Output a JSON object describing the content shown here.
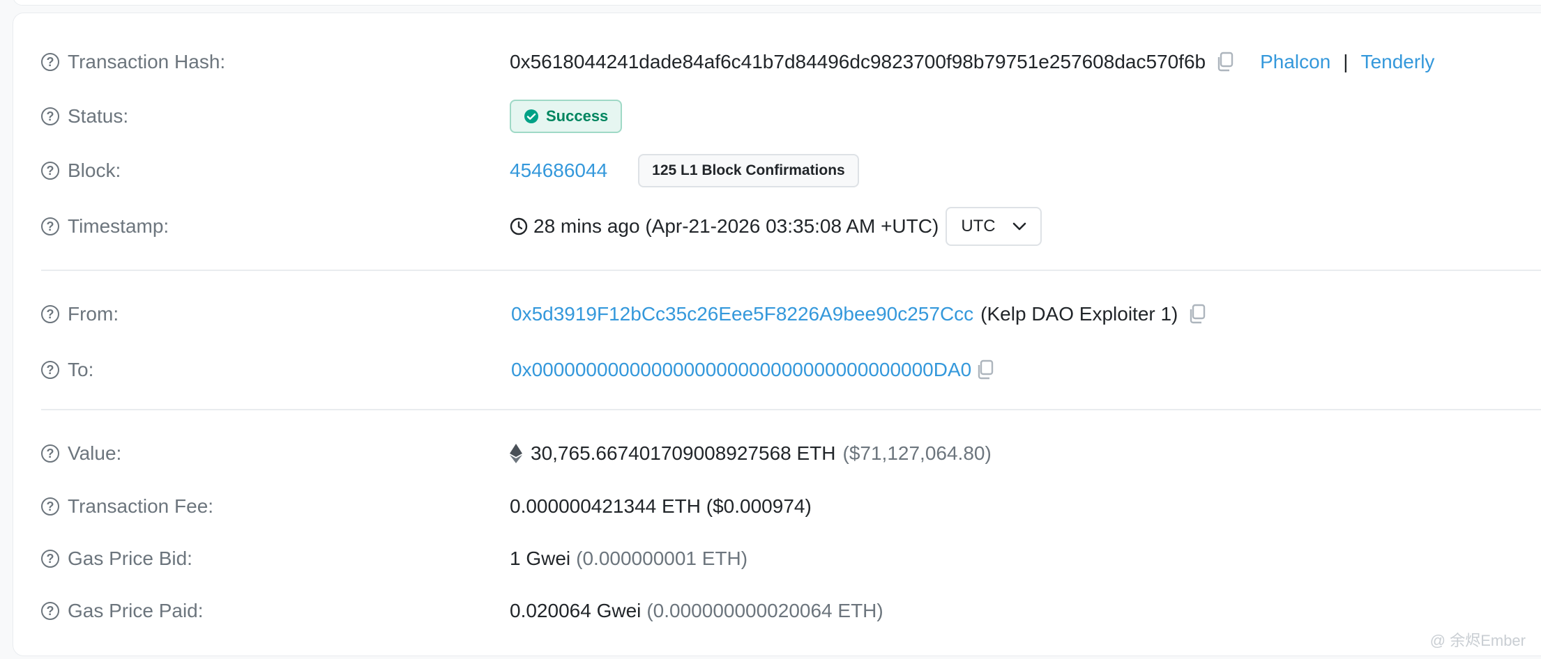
{
  "transaction_hash": {
    "label": "Transaction Hash:",
    "value": "0x5618044241dade84af6c41b7d84496dc9823700f98b79751e257608dac570f6b",
    "links": [
      "Phalcon",
      "Tenderly"
    ],
    "separator": "|"
  },
  "status": {
    "label": "Status:",
    "value": "Success"
  },
  "block": {
    "label": "Block:",
    "number": "454686044",
    "confirmations": "125 L1 Block Confirmations"
  },
  "timestamp": {
    "label": "Timestamp:",
    "value": "28 mins ago (Apr-21-2026 03:35:08 AM +UTC)",
    "timezone": "UTC"
  },
  "from": {
    "label": "From:",
    "address": "0x5d3919F12bCc35c26Eee5F8226A9bee90c257Ccc",
    "name_tag": "(Kelp DAO Exploiter 1)"
  },
  "to": {
    "label": "To:",
    "address": "0x0000000000000000000000000000000000000DA0"
  },
  "value": {
    "label": "Value:",
    "amount": "30,765.667401709008927568 ETH",
    "usd": "($71,127,064.80)"
  },
  "transaction_fee": {
    "label": "Transaction Fee:",
    "value": "0.000000421344 ETH ($0.000974)"
  },
  "gas_price_bid": {
    "label": "Gas Price Bid:",
    "value": "1 Gwei",
    "eth": "(0.000000001 ETH)"
  },
  "gas_price_paid": {
    "label": "Gas Price Paid:",
    "value": "0.020064 Gwei",
    "eth": "(0.000000000020064 ETH)"
  },
  "watermark": "@ 余烬Ember",
  "icons": {
    "help": "question-circle-icon",
    "copy": "copy-icon",
    "success": "check-circle-icon",
    "clock": "clock-icon",
    "chevron": "chevron-down-icon",
    "eth": "ethereum-icon"
  },
  "colors": {
    "link": "#3498db",
    "success_text": "#00855f",
    "success_bg": "#e6f6f1",
    "label": "#6c757d",
    "divider": "#e9ecef"
  }
}
